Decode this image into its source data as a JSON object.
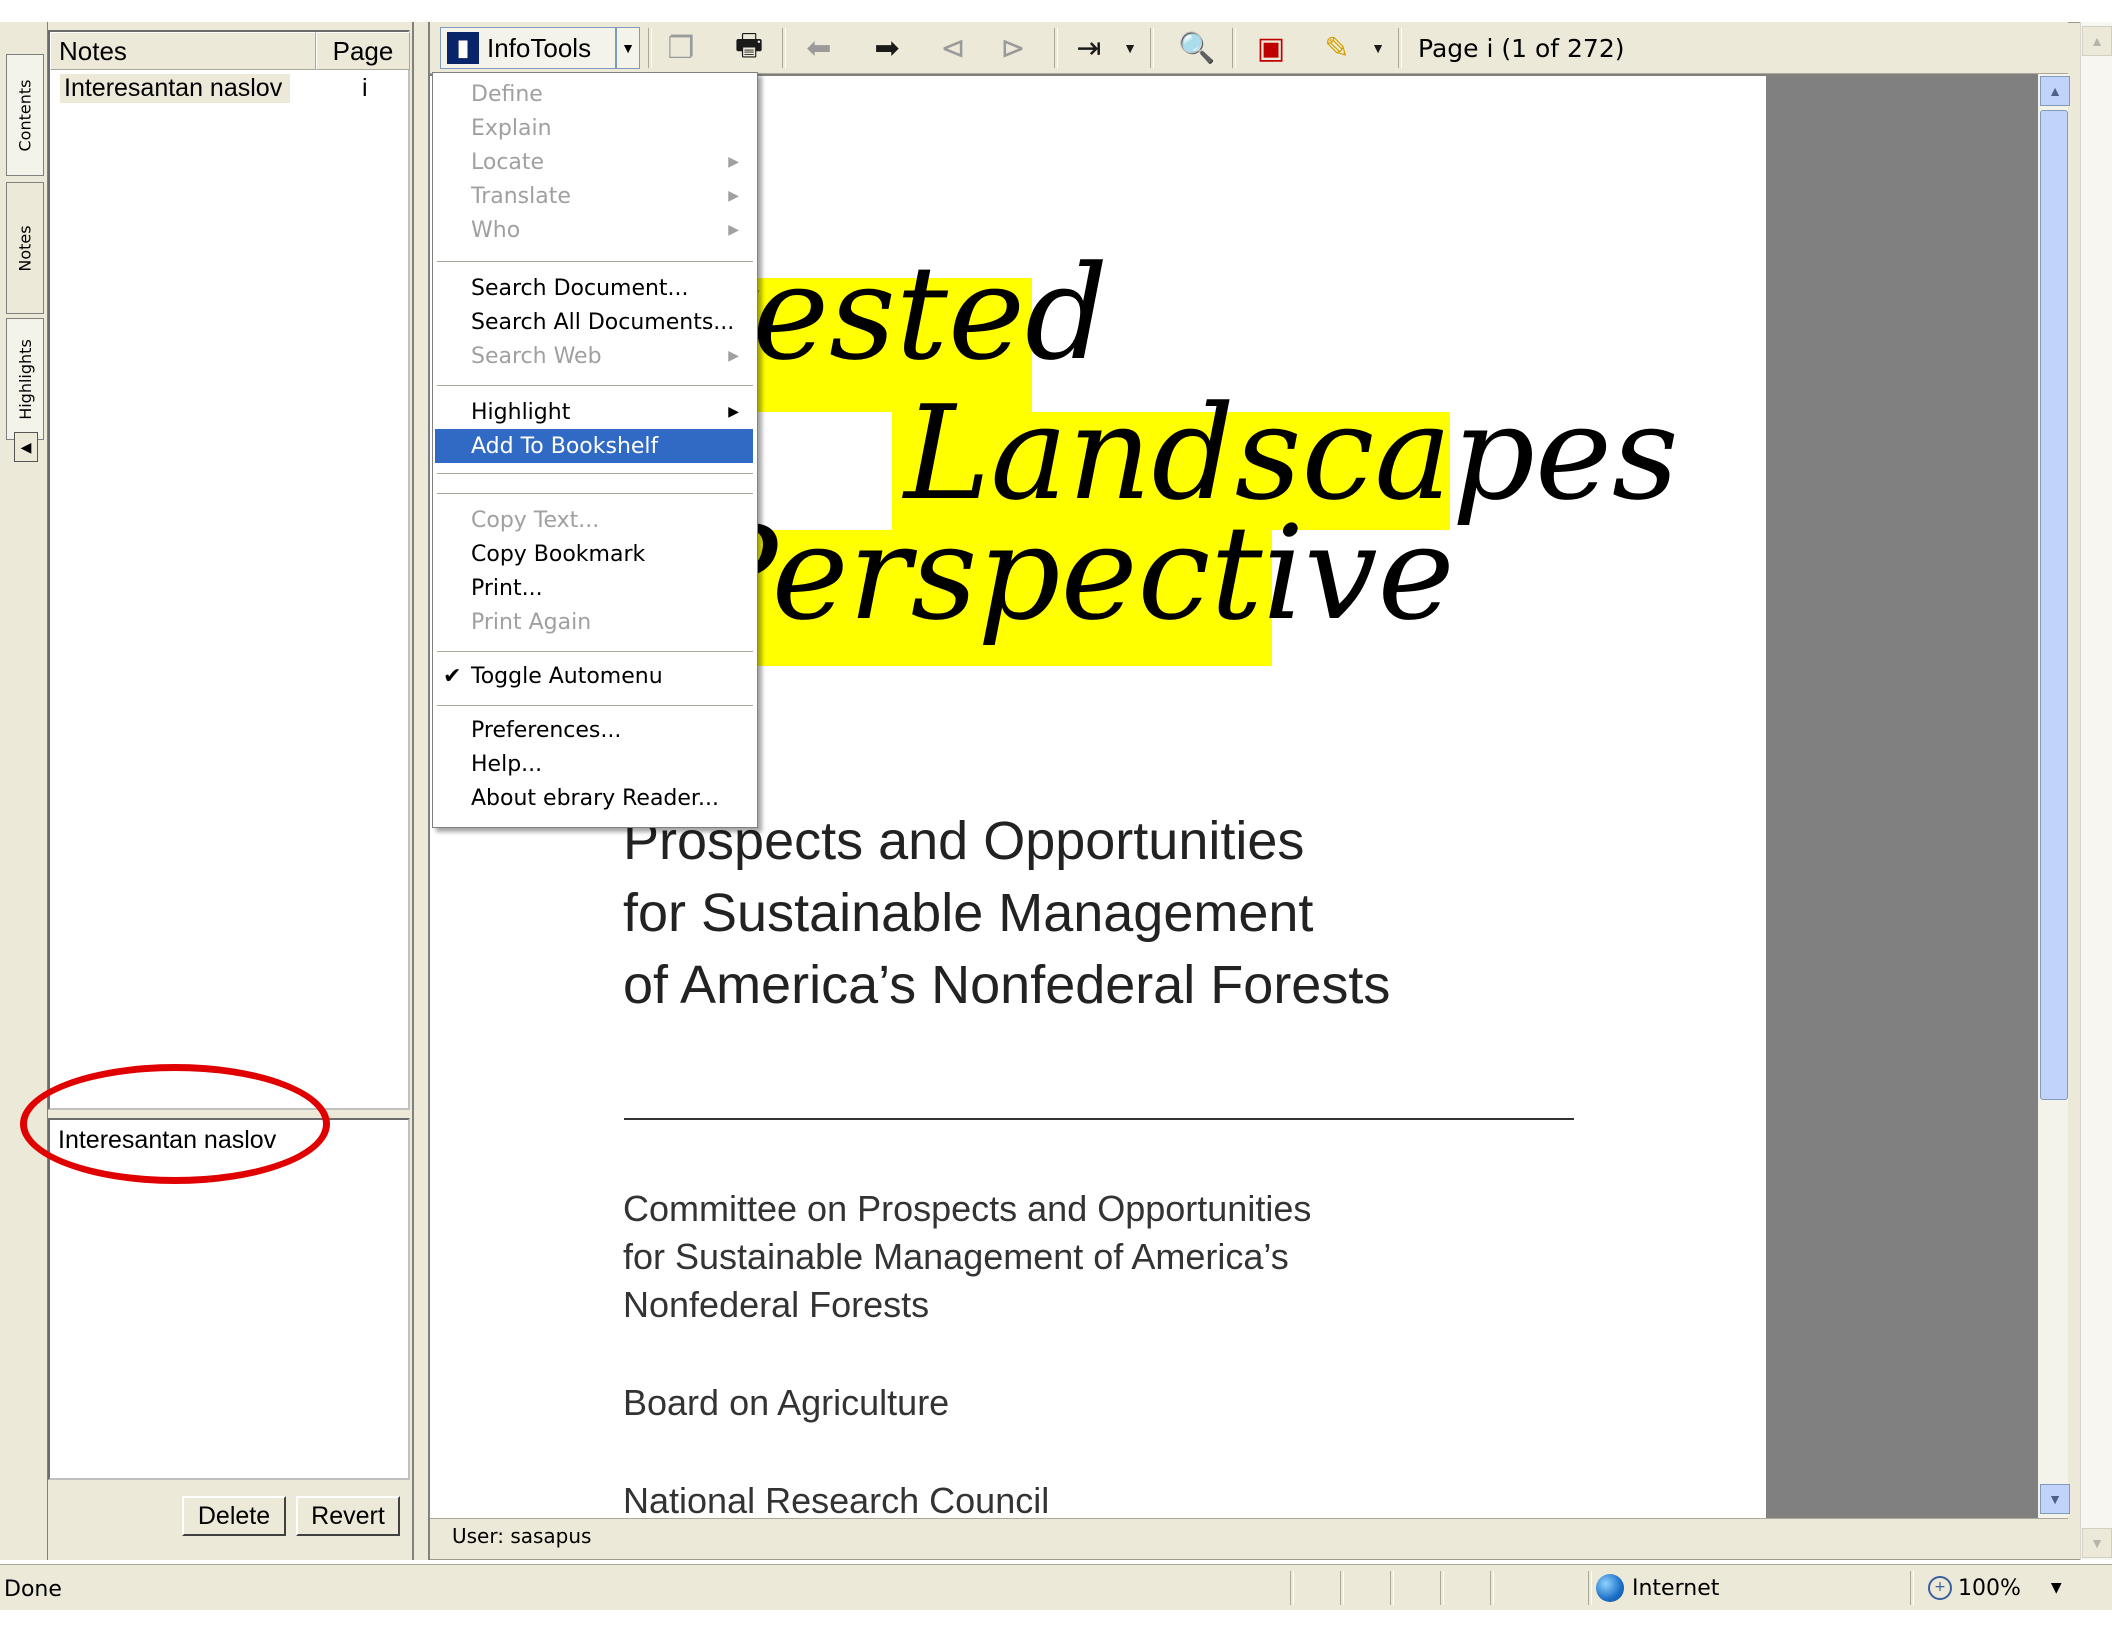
{
  "side_tabs": {
    "contents": "Contents",
    "notes": "Notes",
    "highlights": "Highlights",
    "collapse_arrow": "◀"
  },
  "notes_panel": {
    "col_notes": "Notes",
    "col_page": "Page",
    "rows": [
      {
        "title": "Interesantan naslov",
        "page": "i"
      }
    ],
    "editor_text": "Interesantan naslov",
    "delete_label": "Delete",
    "revert_label": "Revert"
  },
  "toolbar": {
    "infotools_label": "InfoTools",
    "page_indicator": "Page i (1 of 272)",
    "icons": [
      "copy-icon",
      "print-icon",
      "back-arrow-icon",
      "forward-arrow-icon",
      "prev-search-icon",
      "next-search-icon",
      "go-to-page-icon",
      "zoom-icon",
      "bookmark-icon",
      "highlighter-icon"
    ]
  },
  "menu": {
    "items": [
      {
        "label": "Define",
        "enabled": false,
        "submenu": false
      },
      {
        "label": "Explain",
        "enabled": false,
        "submenu": false
      },
      {
        "label": "Locate",
        "enabled": false,
        "submenu": true
      },
      {
        "label": "Translate",
        "enabled": false,
        "submenu": true
      },
      {
        "label": "Who",
        "enabled": false,
        "submenu": true
      },
      {
        "label": "Search Document...",
        "enabled": true,
        "submenu": false
      },
      {
        "label": "Search All Documents...",
        "enabled": true,
        "submenu": false
      },
      {
        "label": "Search Web",
        "enabled": false,
        "submenu": true
      },
      {
        "label": "Highlight",
        "enabled": true,
        "submenu": true
      },
      {
        "label": "Add To Bookshelf",
        "enabled": true,
        "submenu": false,
        "selected": true
      },
      {
        "label": "Copy Text...",
        "enabled": false,
        "submenu": false
      },
      {
        "label": "Copy Bookmark",
        "enabled": true,
        "submenu": false
      },
      {
        "label": "Print...",
        "enabled": true,
        "submenu": false
      },
      {
        "label": "Print Again",
        "enabled": false,
        "submenu": false
      },
      {
        "label": "Toggle Automenu",
        "enabled": true,
        "submenu": false,
        "checked": true
      },
      {
        "label": "Preferences...",
        "enabled": true,
        "submenu": false
      },
      {
        "label": "Help...",
        "enabled": true,
        "submenu": false
      },
      {
        "label": "About ebrary Reader...",
        "enabled": true,
        "submenu": false
      }
    ]
  },
  "document": {
    "title_line1": "rested",
    "title_line2": "Landscapes",
    "title_line3": "Perspective",
    "subtitle": [
      "Prospects and Opportunities",
      "for Sustainable Management",
      "of America’s Nonfederal Forests"
    ],
    "committee": [
      "Committee on Prospects and Opportunities",
      "for Sustainable Management of America’s",
      "Nonfederal Forests"
    ],
    "board": "Board on Agriculture",
    "council": "National Research Council",
    "highlight_color": "#ffff00"
  },
  "user_bar": "User: sasapus",
  "status_bar": {
    "status": "Done",
    "zone": "Internet",
    "zoom": "100%"
  },
  "annotation_color": "#e00000"
}
